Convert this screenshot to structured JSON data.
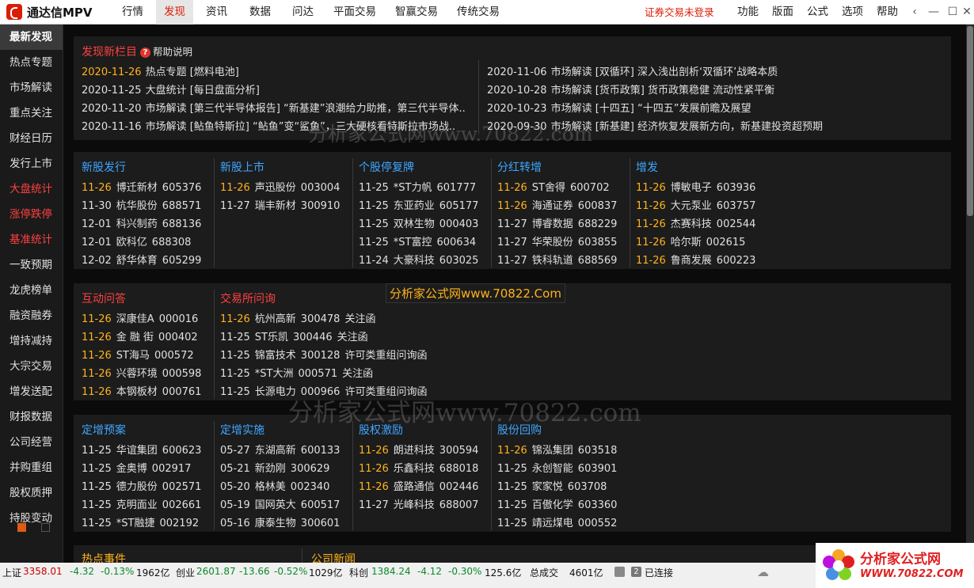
{
  "app": {
    "title": "通达信MPV"
  },
  "menu": [
    "行情",
    "发现",
    "资讯",
    "数据",
    "问达",
    "平面交易",
    "智赢交易",
    "传统交易"
  ],
  "active_menu": "发现",
  "login_status": "证券交易未登录",
  "right_menu": [
    "功能",
    "版面",
    "公式",
    "选项",
    "帮助"
  ],
  "sidebar": [
    "最新发现",
    "热点专题",
    "市场解读",
    "重点关注",
    "财经日历",
    "发行上市",
    "大盘统计",
    "涨停跌停",
    "基准统计",
    "一致预期",
    "龙虎榜单",
    "融资融券",
    "增持减持",
    "大宗交易",
    "增发送配",
    "财报数据",
    "公司经营",
    "并购重组",
    "股权质押",
    "持股变动"
  ],
  "sidebar_red": [
    "大盘统计",
    "涨停跌停",
    "基准统计"
  ],
  "discover": {
    "title": "发现新栏目",
    "help": "帮助说明",
    "left": [
      {
        "date": "2020-11-26",
        "text": "热点专题 [燃料电池]",
        "hi": true
      },
      {
        "date": "2020-11-25",
        "text": "大盘统计 [每日盘面分析]",
        "hi": false
      },
      {
        "date": "2020-11-20",
        "text": "市场解读 [第三代半导体报告] “新基建”浪潮给力助推，第三代半导体..",
        "hi": false
      },
      {
        "date": "2020-11-16",
        "text": "市场解读 [鲇鱼特斯拉] “鲇鱼”变“鲨鱼”，三大硬核看特斯拉市场战..",
        "hi": false
      }
    ],
    "right": [
      {
        "date": "2020-11-06",
        "text": "市场解读 [双循环] 深入浅出剖析‘双循环’战略本质"
      },
      {
        "date": "2020-10-28",
        "text": "市场解读 [货币政策] 货币政策稳健 流动性紧平衡"
      },
      {
        "date": "2020-10-23",
        "text": "市场解读 [十四五] “十四五”发展前瞻及展望"
      },
      {
        "date": "2020-09-30",
        "text": "市场解读 [新基建] 经济恢复发展新方向，新基建投资超预期"
      }
    ]
  },
  "panel2": [
    {
      "title": "新股发行",
      "color": "blue",
      "rows": [
        [
          "11-26",
          "博迁新材",
          "605376",
          true
        ],
        [
          "11-30",
          "杭华股份",
          "688571",
          false
        ],
        [
          "12-01",
          "科兴制药",
          "688136",
          false
        ],
        [
          "12-01",
          "欧科亿",
          "688308",
          false
        ],
        [
          "12-02",
          "舒华体育",
          "605299",
          false
        ]
      ]
    },
    {
      "title": "新股上市",
      "color": "blue",
      "rows": [
        [
          "11-26",
          "声迅股份",
          "003004",
          true
        ],
        [
          "11-27",
          "瑞丰新材",
          "300910",
          false
        ]
      ]
    },
    {
      "title": "个股停复牌",
      "color": "blue",
      "rows": [
        [
          "11-25",
          "*ST力帆",
          "601777",
          false
        ],
        [
          "11-25",
          "东亚药业",
          "605177",
          false
        ],
        [
          "11-25",
          "双林生物",
          "000403",
          false
        ],
        [
          "11-25",
          "*ST富控",
          "600634",
          false
        ],
        [
          "11-24",
          "大豪科技",
          "603025",
          false
        ]
      ]
    },
    {
      "title": "分红转增",
      "color": "blue",
      "rows": [
        [
          "11-26",
          "ST舍得",
          "600702",
          true
        ],
        [
          "11-26",
          "海通证券",
          "600837",
          true
        ],
        [
          "11-27",
          "博睿数据",
          "688229",
          false
        ],
        [
          "11-27",
          "华荣股份",
          "603855",
          false
        ],
        [
          "11-27",
          "铁科轨道",
          "688569",
          false
        ]
      ]
    },
    {
      "title": "增发",
      "color": "blue",
      "rows": [
        [
          "11-26",
          "博敏电子",
          "603936",
          true
        ],
        [
          "11-26",
          "大元泵业",
          "603757",
          true
        ],
        [
          "11-26",
          "杰赛科技",
          "002544",
          true
        ],
        [
          "11-26",
          "哈尔斯",
          "002615",
          true
        ],
        [
          "11-26",
          "鲁商发展",
          "600223",
          true
        ]
      ]
    }
  ],
  "panel3": [
    {
      "title": "互动问答",
      "color": "red",
      "rows": [
        [
          "11-26",
          "深康佳A",
          "000016",
          true,
          ""
        ],
        [
          "11-26",
          "金 融 街",
          "000402",
          true,
          ""
        ],
        [
          "11-26",
          "ST海马",
          "000572",
          true,
          ""
        ],
        [
          "11-26",
          "兴蓉环境",
          "000598",
          true,
          ""
        ],
        [
          "11-26",
          "本钢板材",
          "000761",
          true,
          ""
        ]
      ]
    },
    {
      "title": "交易所问询",
      "color": "red",
      "rows": [
        [
          "11-26",
          "杭州高新",
          "300478",
          true,
          "关注函"
        ],
        [
          "11-25",
          "ST乐凯",
          "300446",
          false,
          "关注函"
        ],
        [
          "11-25",
          "锦富技术",
          "300128",
          false,
          "许可类重组问询函"
        ],
        [
          "11-25",
          "*ST大洲",
          "000571",
          false,
          "关注函"
        ],
        [
          "11-25",
          "长源电力",
          "000966",
          false,
          "许可类重组问询函"
        ]
      ]
    }
  ],
  "panel4": [
    {
      "title": "定增预案",
      "color": "blue",
      "rows": [
        [
          "11-25",
          "华谊集团",
          "600623",
          false
        ],
        [
          "11-25",
          "金奥博",
          "002917",
          false
        ],
        [
          "11-25",
          "德力股份",
          "002571",
          false
        ],
        [
          "11-25",
          "克明面业",
          "002661",
          false
        ],
        [
          "11-25",
          "*ST融捷",
          "002192",
          false
        ]
      ]
    },
    {
      "title": "定增实施",
      "color": "blue",
      "rows": [
        [
          "05-27",
          "东湖高新",
          "600133",
          false
        ],
        [
          "05-21",
          "新劲刚",
          "300629",
          false
        ],
        [
          "05-20",
          "格林美",
          "002340",
          false
        ],
        [
          "05-19",
          "国网英大",
          "600517",
          false
        ],
        [
          "05-16",
          "康泰生物",
          "300601",
          false
        ]
      ]
    },
    {
      "title": "股权激励",
      "color": "blue",
      "rows": [
        [
          "11-26",
          "朗进科技",
          "300594",
          true
        ],
        [
          "11-26",
          "乐鑫科技",
          "688018",
          true
        ],
        [
          "11-26",
          "盛路通信",
          "002446",
          true
        ],
        [
          "11-27",
          "光峰科技",
          "688007",
          false
        ]
      ]
    },
    {
      "title": "股份回购",
      "color": "blue",
      "rows": [
        [
          "11-26",
          "锦泓集团",
          "603518",
          true
        ],
        [
          "11-25",
          "永创智能",
          "603901",
          false
        ],
        [
          "11-25",
          "家家悦",
          "603708",
          false
        ],
        [
          "11-25",
          "百傲化学",
          "603360",
          false
        ],
        [
          "11-25",
          "靖远煤电",
          "000552",
          false
        ]
      ]
    }
  ],
  "panel5": [
    "热点事件",
    "公司新闻"
  ],
  "watermarks": [
    "分析家公式网www.70822.com",
    "分析家公式网www.70822.Com",
    "分析家公式网www.70822.com"
  ],
  "status": {
    "sh_label": "上证",
    "sh_val": "3358.01",
    "sh_chg": "-4.32",
    "sh_pct": "-0.13%",
    "sh_amt": "1962亿",
    "cy_label": "创业",
    "cy_val": "2601.87",
    "cy_chg": "-13.66",
    "cy_pct": "-0.52%",
    "cy_amt": "1029亿",
    "kc_label": "科创",
    "kc_val": "1384.24",
    "kc_chg": "-4.12",
    "kc_pct": "-0.30%",
    "kc_amt": "125.6亿",
    "total_label": "总成交",
    "total_val": "4601亿",
    "conn_count": "2",
    "conn": "已连接"
  },
  "badge": {
    "line1": "分析家公式网",
    "line2": "WWW.70822.COM"
  }
}
